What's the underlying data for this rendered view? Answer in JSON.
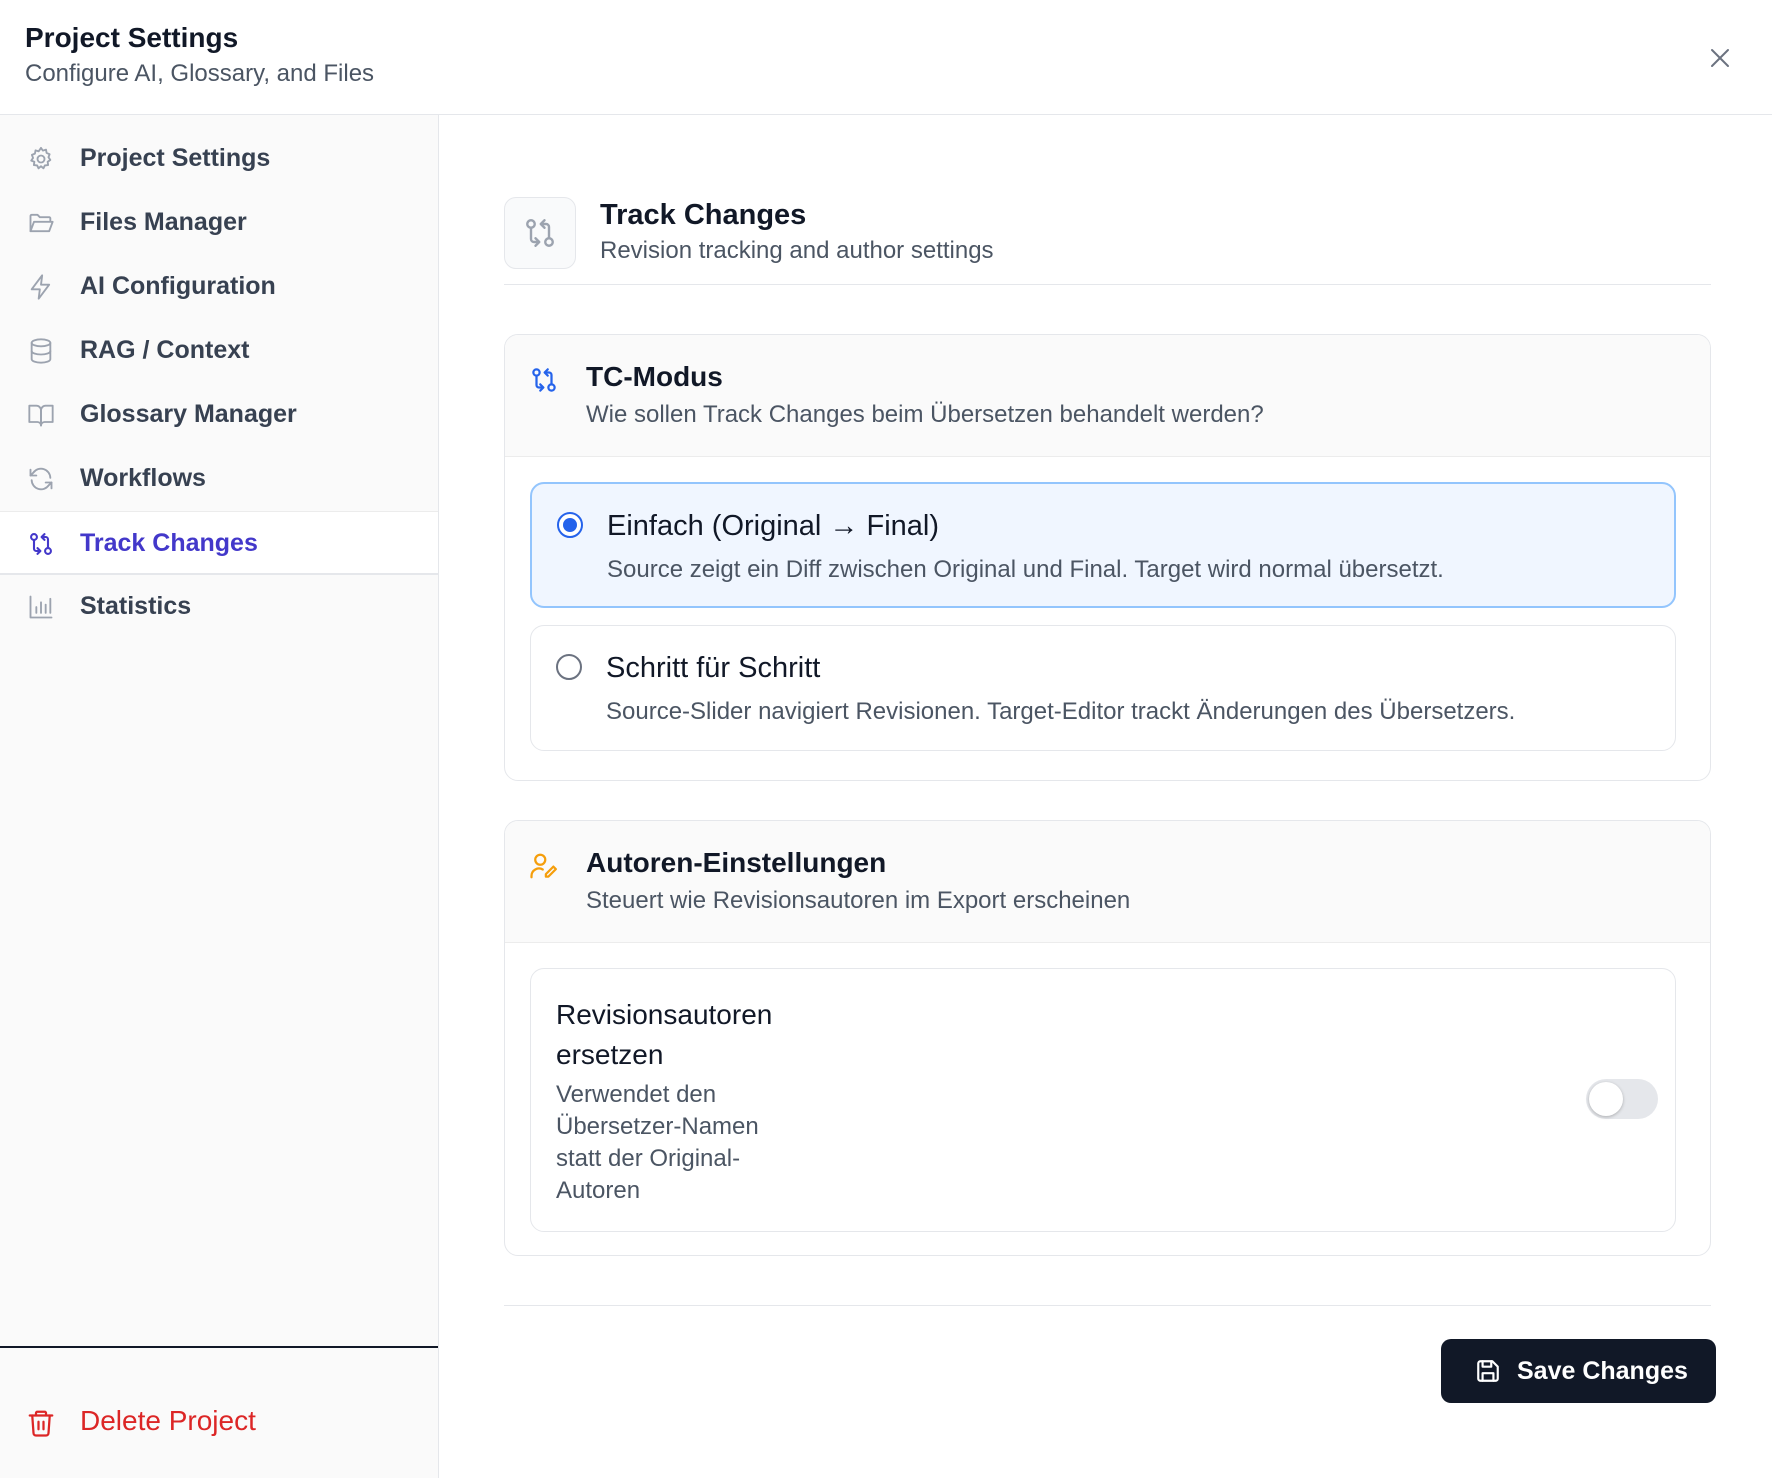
{
  "header": {
    "title": "Project Settings",
    "subtitle": "Configure AI, Glossary, and Files"
  },
  "sidebar": {
    "items": [
      {
        "label": "Project Settings",
        "icon": "gear-icon",
        "active": false
      },
      {
        "label": "Files Manager",
        "icon": "folder-open-icon",
        "active": false
      },
      {
        "label": "AI Configuration",
        "icon": "lightning-icon",
        "active": false
      },
      {
        "label": "RAG / Context",
        "icon": "database-icon",
        "active": false
      },
      {
        "label": "Glossary Manager",
        "icon": "book-open-icon",
        "active": false
      },
      {
        "label": "Workflows",
        "icon": "refresh-icon",
        "active": false
      },
      {
        "label": "Track Changes",
        "icon": "git-compare-icon",
        "active": true
      },
      {
        "label": "Statistics",
        "icon": "bar-chart-icon",
        "active": false
      }
    ],
    "delete_label": "Delete Project"
  },
  "section": {
    "title": "Track Changes",
    "subtitle": "Revision tracking and author settings"
  },
  "tc_mode": {
    "title": "TC-Modus",
    "subtitle": "Wie sollen Track Changes beim Übersetzen behandelt werden?",
    "options": [
      {
        "title": "Einfach (Original → Final)",
        "description": "Source zeigt ein Diff zwischen Original und Final. Target wird normal übersetzt.",
        "selected": true
      },
      {
        "title": "Schritt für Schritt",
        "description": "Source-Slider navigiert Revisionen. Target-Editor trackt Änderungen des Übersetzers.",
        "selected": false
      }
    ]
  },
  "authors": {
    "title": "Autoren-Einstellungen",
    "subtitle": "Steuert wie Revisionsautoren im Export erscheinen",
    "setting": {
      "title": "Revisionsautoren ersetzen",
      "description": "Verwendet den Übersetzer-Namen statt der Original-Autoren",
      "enabled": false
    }
  },
  "footer": {
    "save_label": "Save Changes"
  },
  "colors": {
    "accent": "#4338ca",
    "radio_selected": "#2563eb",
    "danger": "#dc2626",
    "author_icon": "#f59e0b",
    "save_button": "#111827"
  }
}
